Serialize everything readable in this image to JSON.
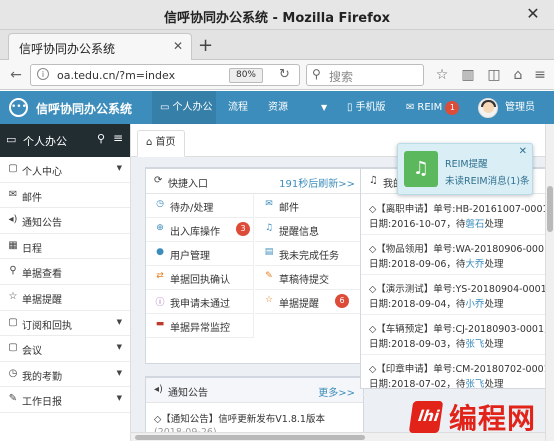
{
  "window": {
    "title": "信呼协同办公系统 - Mozilla Firefox"
  },
  "tab": {
    "title": "信呼协同办公系统"
  },
  "navbar": {
    "url": "oa.tedu.cn/?m=index",
    "zoom": "80%",
    "search_placeholder": "搜索"
  },
  "header": {
    "app_title": "信呼协同办公系统",
    "nav": [
      "个人办公",
      "流程",
      "资源"
    ],
    "mobile": "手机版",
    "reim": "REIM",
    "reim_badge": "1",
    "user": "管理员"
  },
  "sidebar": {
    "title": "个人办公",
    "items": [
      {
        "label": "个人中心",
        "icon": "bookmark-icon",
        "caret": true
      },
      {
        "label": "邮件",
        "icon": "envelope-icon",
        "caret": false
      },
      {
        "label": "通知公告",
        "icon": "volume-icon",
        "caret": false
      },
      {
        "label": "日程",
        "icon": "calendar-icon",
        "caret": false
      },
      {
        "label": "单据查看",
        "icon": "search-icon",
        "caret": false
      },
      {
        "label": "单据提醒",
        "icon": "star-icon",
        "caret": false
      },
      {
        "label": "订阅和回执",
        "icon": "bookmark-icon",
        "caret": true
      },
      {
        "label": "会议",
        "icon": "bookmark-icon",
        "caret": true
      },
      {
        "label": "我的考勤",
        "icon": "clock-icon",
        "caret": true
      },
      {
        "label": "工作日报",
        "icon": "edit-icon",
        "caret": true
      }
    ]
  },
  "main": {
    "breadcrumb": "首页",
    "quick": {
      "title": "快捷入口",
      "refresh": "191秒后刷新>>",
      "items": [
        {
          "label": "待办/处理",
          "icon": "clock-icon",
          "color": "#3c8dbc",
          "badge": ""
        },
        {
          "label": "邮件",
          "icon": "envelope-icon",
          "color": "#3c8dbc",
          "badge": ""
        },
        {
          "label": "出入库操作",
          "icon": "plus-circle-icon",
          "color": "#3c8dbc",
          "badge": "3"
        },
        {
          "label": "提醒信息",
          "icon": "bell-icon",
          "color": "#3c8dbc",
          "badge": ""
        },
        {
          "label": "用户管理",
          "icon": "user-icon",
          "color": "#3c8dbc",
          "badge": ""
        },
        {
          "label": "我未完成任务",
          "icon": "list-icon",
          "color": "#3c8dbc",
          "badge": ""
        },
        {
          "label": "单据回执确认",
          "icon": "exchange-icon",
          "color": "#e67e22",
          "badge": ""
        },
        {
          "label": "草稿待提交",
          "icon": "edit-icon",
          "color": "#e67e22",
          "badge": ""
        },
        {
          "label": "我申请未通过",
          "icon": "info-circle-icon",
          "color": "#9b59b6",
          "badge": ""
        },
        {
          "label": "单据提醒",
          "icon": "star-icon",
          "color": "#e67e22",
          "badge": "6"
        },
        {
          "label": "单据异常监控",
          "icon": "briefcase-icon",
          "color": "#c0392b",
          "badge": ""
        }
      ]
    },
    "notice": {
      "title": "通知公告",
      "more": "更多>>",
      "line1": "◇【通知公告】信呼更新发布V1.8.1版本",
      "line2": "(2018-09-26)"
    },
    "messages": {
      "title": "我的",
      "items": [
        {
          "line1": "◇【离职申请】单号:HB-20161007-0001",
          "date_prefix": "日期:2016-10-07，待",
          "who": "磐石",
          "suffix": "处理"
        },
        {
          "line1": "◇【物品领用】单号:WA-20180906-0001,",
          "date_prefix": "日期:2018-09-06，待",
          "who": "大乔",
          "suffix": "处理"
        },
        {
          "line1": "◇【演示测试】单号:YS-20180904-0001,",
          "date_prefix": "日期:2018-09-04，待",
          "who": "小乔",
          "suffix": "处理"
        },
        {
          "line1": "◇【车辆预定】单号:CJ-20180903-0001,",
          "date_prefix": "日期:2018-09-03，待",
          "who": "张飞",
          "suffix": "处理"
        },
        {
          "line1": "◇【印章申请】单号:CM-20180702-0001",
          "date_prefix": "日期:2018-07-02，待",
          "who": "张飞",
          "suffix": "处理"
        }
      ]
    }
  },
  "toast": {
    "title": "REIM提醒",
    "message": "未读REIM消息(1)条"
  },
  "watermark": {
    "text": "编程网",
    "mark": "lhi"
  }
}
